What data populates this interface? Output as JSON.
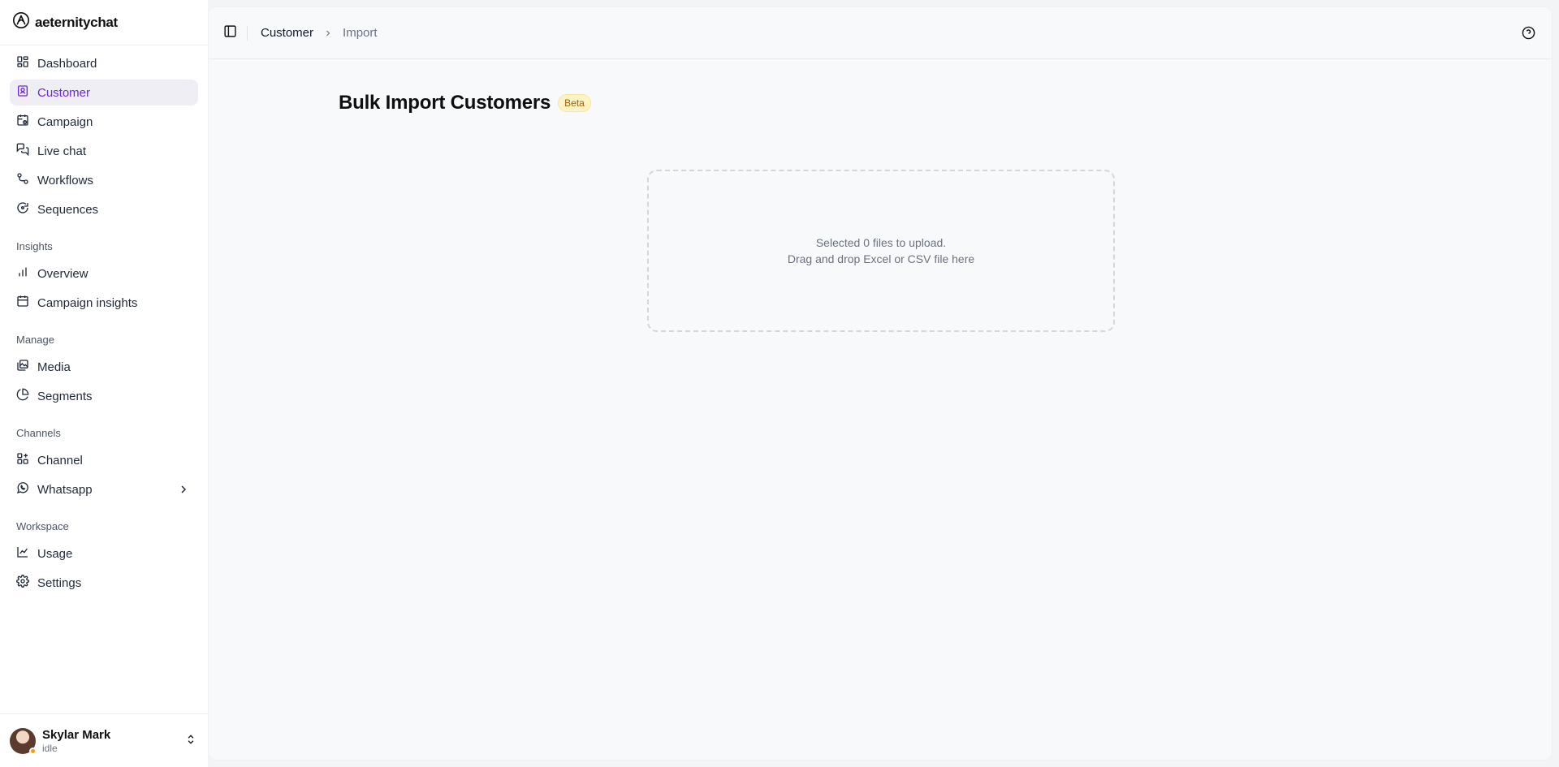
{
  "brand": {
    "name": "aeternitychat"
  },
  "nav": {
    "main": [
      {
        "label": "Dashboard",
        "icon": "dashboard-icon"
      },
      {
        "label": "Customer",
        "icon": "customer-icon",
        "active": true
      },
      {
        "label": "Campaign",
        "icon": "campaign-icon"
      },
      {
        "label": "Live chat",
        "icon": "chat-icon"
      },
      {
        "label": "Workflows",
        "icon": "workflow-icon"
      },
      {
        "label": "Sequences",
        "icon": "sequence-icon"
      }
    ],
    "insights_label": "Insights",
    "insights": [
      {
        "label": "Overview",
        "icon": "bar-chart-icon"
      },
      {
        "label": "Campaign insights",
        "icon": "calendar-icon"
      }
    ],
    "manage_label": "Manage",
    "manage": [
      {
        "label": "Media",
        "icon": "media-icon"
      },
      {
        "label": "Segments",
        "icon": "pie-chart-icon"
      }
    ],
    "channels_label": "Channels",
    "channels": [
      {
        "label": "Channel",
        "icon": "grid-plus-icon"
      },
      {
        "label": "Whatsapp",
        "icon": "whatsapp-icon"
      }
    ],
    "workspace_label": "Workspace",
    "workspace": [
      {
        "label": "Usage",
        "icon": "line-chart-icon"
      },
      {
        "label": "Settings",
        "icon": "gear-icon"
      }
    ]
  },
  "user": {
    "name": "Skylar Mark",
    "status": "idle",
    "status_color": "#f59e0b"
  },
  "breadcrumb": {
    "parent": "Customer",
    "current": "Import"
  },
  "page": {
    "title": "Bulk Import Customers",
    "badge": "Beta"
  },
  "upload": {
    "line1": "Selected 0 files to upload.",
    "line2": "Drag and drop Excel or CSV file here"
  },
  "colors": {
    "accent": "#6d28d9",
    "active_bg": "#f0eef5"
  }
}
